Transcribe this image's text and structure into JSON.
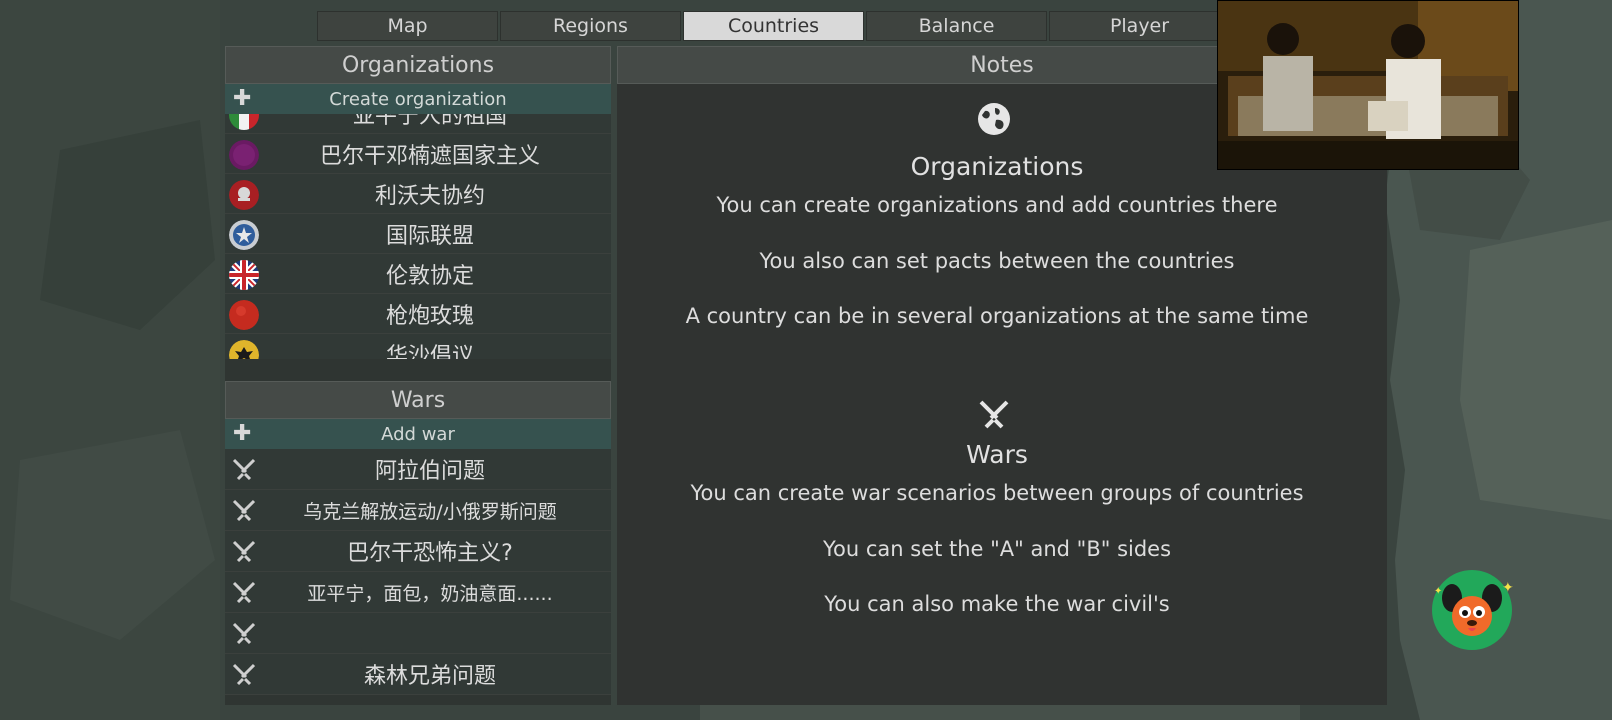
{
  "tabs": [
    {
      "label": "Map",
      "active": false
    },
    {
      "label": "Regions",
      "active": false
    },
    {
      "label": "Countries",
      "active": true
    },
    {
      "label": "Balance",
      "active": false
    },
    {
      "label": "Player",
      "active": false
    }
  ],
  "organizations": {
    "header": "Organizations",
    "create_label": "Create organization",
    "items": [
      {
        "label": "亚平宁人的祖国",
        "flag": "italy-flag"
      },
      {
        "label": "巴尔干邓楠遮国家主义",
        "flag": "purple-flag"
      },
      {
        "label": "利沃夫协约",
        "flag": "red-emblem-flag"
      },
      {
        "label": "国际联盟",
        "flag": "blue-star-flag"
      },
      {
        "label": "伦敦协定",
        "flag": "union-jack-flag"
      },
      {
        "label": "枪炮玫瑰",
        "flag": "red-flag"
      },
      {
        "label": "华沙倡议",
        "flag": "eagle-flag"
      }
    ]
  },
  "wars": {
    "header": "Wars",
    "add_label": "Add war",
    "items": [
      {
        "label": "阿拉伯问题"
      },
      {
        "label": "乌克兰解放运动/小俄罗斯问题"
      },
      {
        "label": "巴尔干恐怖主义?"
      },
      {
        "label": "亚平宁，面包，奶油意面......"
      },
      {
        "label": ""
      },
      {
        "label": "森林兄弟问题"
      }
    ]
  },
  "notes": {
    "header": "Notes",
    "organizations": {
      "title": "Organizations",
      "icon": "globe-icon",
      "lines": [
        "You can create organizations and add countries there",
        "You also can set pacts between the countries",
        "A country can be in several organizations at the same time"
      ]
    },
    "wars": {
      "title": "Wars",
      "icon": "crossed-swords-icon",
      "lines": [
        "You can create war scenarios between groups of countries",
        "You can set the \"A\" and \"B\" sides",
        "You can also make the war civil's"
      ]
    }
  },
  "colors": {
    "active_tab": "#d9d9d9",
    "action_row": "#36524f",
    "panel": "#303331",
    "header": "#454a47"
  }
}
